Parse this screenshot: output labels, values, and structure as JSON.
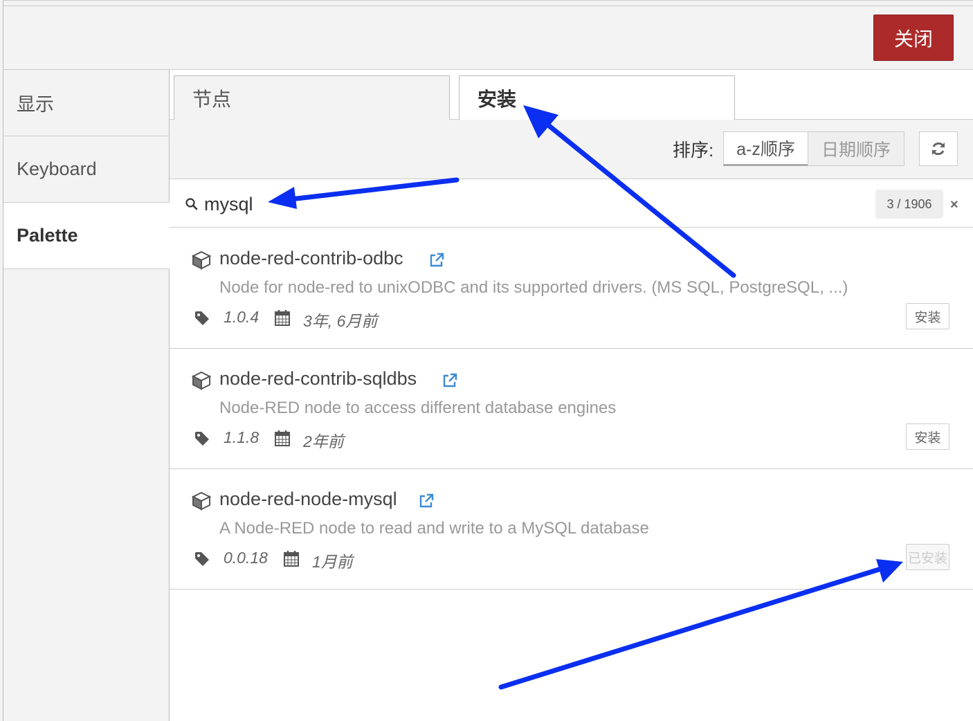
{
  "topbar": {
    "close_label": "关闭"
  },
  "sidebar": {
    "items": [
      {
        "label": "显示"
      },
      {
        "label": "Keyboard"
      },
      {
        "label": "Palette"
      }
    ]
  },
  "tabs": [
    {
      "label": "节点"
    },
    {
      "label": "安装"
    }
  ],
  "sort": {
    "label": "排序:",
    "options": [
      "a-z顺序",
      "日期顺序"
    ],
    "selected": "a-z顺序",
    "refresh_icon": "refresh-icon"
  },
  "search": {
    "value": "mysql",
    "count": "3 / 1906",
    "clear_icon": "×"
  },
  "results": [
    {
      "name": "node-red-contrib-odbc",
      "description": "Node for node-red to unixODBC and its supported drivers. (MS SQL, PostgreSQL, ...)",
      "version": "1.0.4",
      "updated": "3年, 6月前",
      "action": "安装"
    },
    {
      "name": "node-red-contrib-sqldbs",
      "description": "Node-RED node to access different database engines",
      "version": "1.1.8",
      "updated": "2年前",
      "action": "安装"
    },
    {
      "name": "node-red-node-mysql",
      "description": "A Node-RED node to read and write to a MySQL database",
      "version": "0.0.18",
      "updated": "1月前",
      "action": "已安装"
    }
  ],
  "colors": {
    "close_button": "#ad2a2a",
    "annotation_arrow": "#0a2ff0",
    "link": "#3a8ad8"
  }
}
